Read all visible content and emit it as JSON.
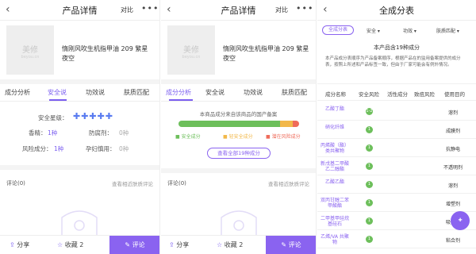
{
  "left": {
    "header": {
      "title": "产品详情",
      "compare": "对比",
      "more": "•••"
    },
    "product": {
      "img_cn": "美修",
      "img_en": "beyou.cn",
      "name": "惰刚风吹生机指甲油 209 繁星夜空"
    },
    "tabs": [
      "成分分析",
      "安全说",
      "功效说",
      "肤质匹配"
    ],
    "safety": {
      "label": "安全星级：",
      "stars": "✚✚✚✚✚"
    },
    "stats": {
      "fragrance_label": "香精：",
      "fragrance_value": "1种",
      "preservative_label": "防腐剂：",
      "preservative_value": "0种",
      "risk_label": "风险成分：",
      "risk_value": "1种",
      "pregnancy_label": "孕妇慎用：",
      "pregnancy_value": "0种"
    },
    "comment": {
      "title": "评论(0)",
      "link": "查看相近肤质评论"
    },
    "footer": {
      "share": "分享",
      "favorite": "收藏 2",
      "comment": "评论"
    }
  },
  "middle": {
    "header": {
      "title": "产品详情",
      "compare": "对比",
      "more": "•••"
    },
    "product": {
      "img_cn": "美修",
      "img_en": "beyou.cn",
      "name": "惰刚风吹生机指甲油 209 繁星夜空"
    },
    "tabs": [
      "成分分析",
      "安全说",
      "功效说",
      "肤质匹配"
    ],
    "info": "本商品成分来自该商品的国产备案",
    "legend": [
      "安全成分",
      "轻安全成分",
      "潜在风险成分"
    ],
    "view_all": "查看全部19种成分",
    "comment": {
      "title": "评论(0)",
      "link": "查看相近肤质评论"
    },
    "footer": {
      "share": "分享",
      "favorite": "收藏 2",
      "comment": "评论"
    }
  },
  "right": {
    "header": {
      "title": "全成分表"
    },
    "filters": [
      "全成分表",
      "安全",
      "功效",
      "肤质匹配"
    ],
    "count": "本产品含19种成分",
    "desc": "本产品成分表顺序为产品备案顺序，根据产品在的监用备案提供的成分表，按照上所述和产品标签一致，但由于厂家可能会有例外情况。",
    "columns": [
      "成分名称",
      "安全风险",
      "活性成分",
      "致痘风险",
      "使用目的"
    ],
    "rows": [
      {
        "name": "乙酸丁酯",
        "risk": "1-2",
        "use": "溶剂"
      },
      {
        "name": "硝化纤维",
        "risk": "1",
        "use": "成膜剂"
      },
      {
        "name": "丙烯酸（酯）类共聚物",
        "risk": "1",
        "use": "抗静电"
      },
      {
        "name": "新戊基二甲酸乙二醇酯",
        "risk": "1",
        "use": "不透明剂"
      },
      {
        "name": "乙酸乙酯",
        "risk": "1",
        "use": "溶剂"
      },
      {
        "name": "双丙甘醇二苯甲酸酯",
        "risk": "1",
        "use": "增塑剂"
      },
      {
        "name": "二甲基甲硅烷基硅石",
        "risk": "1",
        "use": "吸附剂"
      },
      {
        "name": "乙烯/VA 共聚物",
        "risk": "1",
        "use": "粘合剂"
      }
    ]
  },
  "colors": {
    "accent": "#8a63f0",
    "safe": "#6dbf5b",
    "warn": "#f2b84a",
    "risk": "#ef6b5a"
  }
}
